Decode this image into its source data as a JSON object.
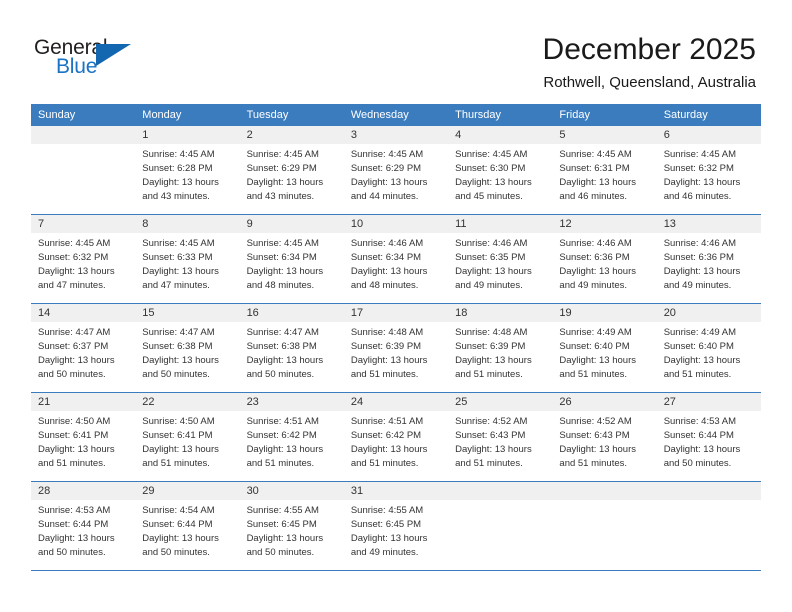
{
  "brand": {
    "name_part1": "General",
    "name_part2": "Blue",
    "triangle_icon": "triangle-icon",
    "accent_color": "#1267b0"
  },
  "header": {
    "title": "December 2025",
    "subtitle": "Rothwell, Queensland, Australia"
  },
  "theme": {
    "header_band": "#3b7cbf",
    "daynum_band": "#f0f0f0",
    "text": "#333333"
  },
  "calendar": {
    "weekdays": [
      "Sunday",
      "Monday",
      "Tuesday",
      "Wednesday",
      "Thursday",
      "Friday",
      "Saturday"
    ],
    "weeks": [
      [
        {
          "day": "",
          "lines": []
        },
        {
          "day": "1",
          "lines": [
            "Sunrise: 4:45 AM",
            "Sunset: 6:28 PM",
            "Daylight: 13 hours",
            "and 43 minutes."
          ]
        },
        {
          "day": "2",
          "lines": [
            "Sunrise: 4:45 AM",
            "Sunset: 6:29 PM",
            "Daylight: 13 hours",
            "and 43 minutes."
          ]
        },
        {
          "day": "3",
          "lines": [
            "Sunrise: 4:45 AM",
            "Sunset: 6:29 PM",
            "Daylight: 13 hours",
            "and 44 minutes."
          ]
        },
        {
          "day": "4",
          "lines": [
            "Sunrise: 4:45 AM",
            "Sunset: 6:30 PM",
            "Daylight: 13 hours",
            "and 45 minutes."
          ]
        },
        {
          "day": "5",
          "lines": [
            "Sunrise: 4:45 AM",
            "Sunset: 6:31 PM",
            "Daylight: 13 hours",
            "and 46 minutes."
          ]
        },
        {
          "day": "6",
          "lines": [
            "Sunrise: 4:45 AM",
            "Sunset: 6:32 PM",
            "Daylight: 13 hours",
            "and 46 minutes."
          ]
        }
      ],
      [
        {
          "day": "7",
          "lines": [
            "Sunrise: 4:45 AM",
            "Sunset: 6:32 PM",
            "Daylight: 13 hours",
            "and 47 minutes."
          ]
        },
        {
          "day": "8",
          "lines": [
            "Sunrise: 4:45 AM",
            "Sunset: 6:33 PM",
            "Daylight: 13 hours",
            "and 47 minutes."
          ]
        },
        {
          "day": "9",
          "lines": [
            "Sunrise: 4:45 AM",
            "Sunset: 6:34 PM",
            "Daylight: 13 hours",
            "and 48 minutes."
          ]
        },
        {
          "day": "10",
          "lines": [
            "Sunrise: 4:46 AM",
            "Sunset: 6:34 PM",
            "Daylight: 13 hours",
            "and 48 minutes."
          ]
        },
        {
          "day": "11",
          "lines": [
            "Sunrise: 4:46 AM",
            "Sunset: 6:35 PM",
            "Daylight: 13 hours",
            "and 49 minutes."
          ]
        },
        {
          "day": "12",
          "lines": [
            "Sunrise: 4:46 AM",
            "Sunset: 6:36 PM",
            "Daylight: 13 hours",
            "and 49 minutes."
          ]
        },
        {
          "day": "13",
          "lines": [
            "Sunrise: 4:46 AM",
            "Sunset: 6:36 PM",
            "Daylight: 13 hours",
            "and 49 minutes."
          ]
        }
      ],
      [
        {
          "day": "14",
          "lines": [
            "Sunrise: 4:47 AM",
            "Sunset: 6:37 PM",
            "Daylight: 13 hours",
            "and 50 minutes."
          ]
        },
        {
          "day": "15",
          "lines": [
            "Sunrise: 4:47 AM",
            "Sunset: 6:38 PM",
            "Daylight: 13 hours",
            "and 50 minutes."
          ]
        },
        {
          "day": "16",
          "lines": [
            "Sunrise: 4:47 AM",
            "Sunset: 6:38 PM",
            "Daylight: 13 hours",
            "and 50 minutes."
          ]
        },
        {
          "day": "17",
          "lines": [
            "Sunrise: 4:48 AM",
            "Sunset: 6:39 PM",
            "Daylight: 13 hours",
            "and 51 minutes."
          ]
        },
        {
          "day": "18",
          "lines": [
            "Sunrise: 4:48 AM",
            "Sunset: 6:39 PM",
            "Daylight: 13 hours",
            "and 51 minutes."
          ]
        },
        {
          "day": "19",
          "lines": [
            "Sunrise: 4:49 AM",
            "Sunset: 6:40 PM",
            "Daylight: 13 hours",
            "and 51 minutes."
          ]
        },
        {
          "day": "20",
          "lines": [
            "Sunrise: 4:49 AM",
            "Sunset: 6:40 PM",
            "Daylight: 13 hours",
            "and 51 minutes."
          ]
        }
      ],
      [
        {
          "day": "21",
          "lines": [
            "Sunrise: 4:50 AM",
            "Sunset: 6:41 PM",
            "Daylight: 13 hours",
            "and 51 minutes."
          ]
        },
        {
          "day": "22",
          "lines": [
            "Sunrise: 4:50 AM",
            "Sunset: 6:41 PM",
            "Daylight: 13 hours",
            "and 51 minutes."
          ]
        },
        {
          "day": "23",
          "lines": [
            "Sunrise: 4:51 AM",
            "Sunset: 6:42 PM",
            "Daylight: 13 hours",
            "and 51 minutes."
          ]
        },
        {
          "day": "24",
          "lines": [
            "Sunrise: 4:51 AM",
            "Sunset: 6:42 PM",
            "Daylight: 13 hours",
            "and 51 minutes."
          ]
        },
        {
          "day": "25",
          "lines": [
            "Sunrise: 4:52 AM",
            "Sunset: 6:43 PM",
            "Daylight: 13 hours",
            "and 51 minutes."
          ]
        },
        {
          "day": "26",
          "lines": [
            "Sunrise: 4:52 AM",
            "Sunset: 6:43 PM",
            "Daylight: 13 hours",
            "and 51 minutes."
          ]
        },
        {
          "day": "27",
          "lines": [
            "Sunrise: 4:53 AM",
            "Sunset: 6:44 PM",
            "Daylight: 13 hours",
            "and 50 minutes."
          ]
        }
      ],
      [
        {
          "day": "28",
          "lines": [
            "Sunrise: 4:53 AM",
            "Sunset: 6:44 PM",
            "Daylight: 13 hours",
            "and 50 minutes."
          ]
        },
        {
          "day": "29",
          "lines": [
            "Sunrise: 4:54 AM",
            "Sunset: 6:44 PM",
            "Daylight: 13 hours",
            "and 50 minutes."
          ]
        },
        {
          "day": "30",
          "lines": [
            "Sunrise: 4:55 AM",
            "Sunset: 6:45 PM",
            "Daylight: 13 hours",
            "and 50 minutes."
          ]
        },
        {
          "day": "31",
          "lines": [
            "Sunrise: 4:55 AM",
            "Sunset: 6:45 PM",
            "Daylight: 13 hours",
            "and 49 minutes."
          ]
        },
        {
          "day": "",
          "lines": []
        },
        {
          "day": "",
          "lines": []
        },
        {
          "day": "",
          "lines": []
        }
      ]
    ]
  }
}
